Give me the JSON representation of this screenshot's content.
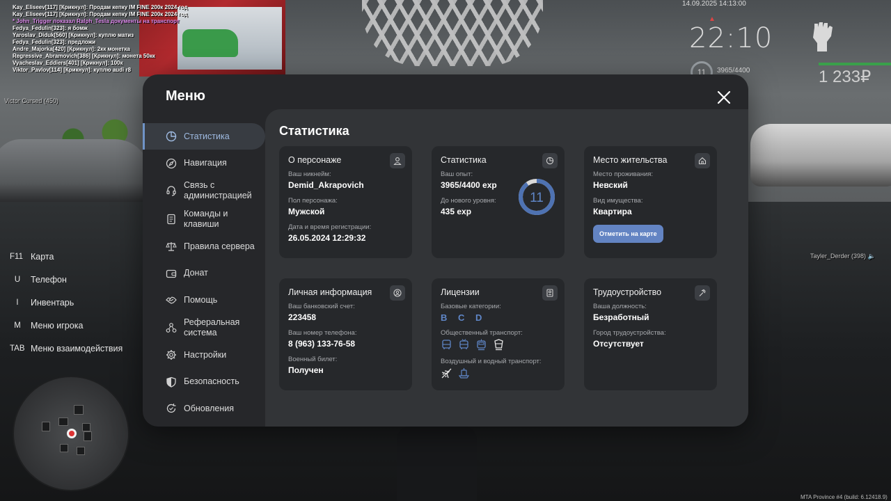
{
  "chat": [
    {
      "text": "Kay_Eliseev[117] [Крикнул]: Продам кепку IM FINE 200к 2024 год",
      "type": "normal"
    },
    {
      "text": "Kay_Eliseev[117] [Крикнул]: Продам кепку IM FINE 200к 2024 год",
      "type": "normal"
    },
    {
      "text": "* John_Trigger показал Ralph_Tesla документы на транспорт",
      "type": "action"
    },
    {
      "text": "Fedya_Fedulin[323]: я бомж",
      "type": "normal"
    },
    {
      "text": "Yaroslav_Diduk[560] [Крикнул]: куплю матиз",
      "type": "normal"
    },
    {
      "text": "Fedya_Fedulin[323]: предложи",
      "type": "normal"
    },
    {
      "text": "Andre_Majorka[420] [Крикнул]: 2кк монетка",
      "type": "normal"
    },
    {
      "text": "Regressive_Abramovich[386] [Крикнул]: монета 50кк",
      "type": "normal"
    },
    {
      "text": "Vyacheslav_Eddiers[401] [Крикнул]: 100к",
      "type": "normal"
    },
    {
      "text": "Viktor_Pavlov[114] [Крикнул]: куплю audi r8",
      "type": "normal"
    }
  ],
  "nametags": {
    "left": "Victor Cursed (450)",
    "right": "Tayler_Derder (398)"
  },
  "hud": {
    "date": "14.09.2025 14:13:00",
    "time": "22:10",
    "level": "11",
    "exp": "3965/4400",
    "money": "1 233₽"
  },
  "keybinds": [
    {
      "key": "F11",
      "label": "Карта"
    },
    {
      "key": "U",
      "label": "Телефон"
    },
    {
      "key": "I",
      "label": "Инвентарь"
    },
    {
      "key": "M",
      "label": "Меню игрока"
    },
    {
      "key": "TAB",
      "label": "Меню взаимодействия"
    }
  ],
  "menu": {
    "title": "Меню",
    "sidebar": [
      {
        "label": "Статистика",
        "icon": "chart-pie-icon",
        "active": true
      },
      {
        "label": "Навигация",
        "icon": "compass-icon"
      },
      {
        "label": "Связь с администрацией",
        "icon": "headset-icon"
      },
      {
        "label": "Команды и клавиши",
        "icon": "document-icon"
      },
      {
        "label": "Правила сервера",
        "icon": "scales-icon"
      },
      {
        "label": "Донат",
        "icon": "wallet-icon"
      },
      {
        "label": "Помощь",
        "icon": "handshake-icon"
      },
      {
        "label": "Реферальная система",
        "icon": "referral-icon"
      },
      {
        "label": "Настройки",
        "icon": "gear-icon"
      },
      {
        "label": "Безопасность",
        "icon": "shield-icon"
      },
      {
        "label": "Обновления",
        "icon": "refresh-icon"
      }
    ],
    "content_title": "Статистика",
    "cards": {
      "character": {
        "title": "О персонаже",
        "nick_label": "Ваш никнейм:",
        "nick": "Demid_Akrapovich",
        "gender_label": "Пол персонажа:",
        "gender": "Мужской",
        "reg_label": "Дата и время регистрации:",
        "reg": "26.05.2024 12:29:32"
      },
      "stats": {
        "title": "Статистика",
        "exp_label": "Ваш опыт:",
        "exp": "3965/4400 exp",
        "next_label": "До нового уровня:",
        "next": "435 exp",
        "level": "11",
        "progress": 0.9
      },
      "residence": {
        "title": "Место жительства",
        "place_label": "Место проживания:",
        "place": "Невский",
        "property_label": "Вид имущества:",
        "property": "Квартира",
        "button": "Отметить на карте"
      },
      "personal": {
        "title": "Личная информация",
        "bank_label": "Ваш банковский счет:",
        "bank": "223458",
        "phone_label": "Ваш номер телефона:",
        "phone": "8 (963) 133-76-58",
        "military_label": "Военный билет:",
        "military": "Получен"
      },
      "licenses": {
        "title": "Лицензии",
        "base_label": "Базовые категории:",
        "categories": "B C D",
        "public_label": "Общественный транспорт:",
        "air_label": "Воздушный и водный транспорт:"
      },
      "employment": {
        "title": "Трудоустройство",
        "position_label": "Ваша должность:",
        "position": "Безработный",
        "city_label": "Город трудоустройства:",
        "city": "Отсутствует"
      }
    }
  },
  "build_info": "MTA Province #4 (build: 6.12418.9)",
  "colors": {
    "accent": "#6384c3",
    "active_text": "#9fbbe2",
    "panel": "#26272a",
    "content": "#323437",
    "card": "#26282b"
  }
}
